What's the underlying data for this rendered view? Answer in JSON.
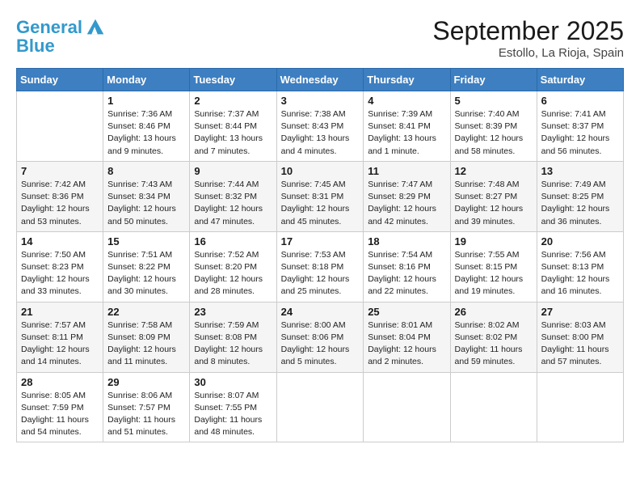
{
  "header": {
    "logo_line1": "General",
    "logo_line2": "Blue",
    "month_title": "September 2025",
    "location": "Estollo, La Rioja, Spain"
  },
  "weekdays": [
    "Sunday",
    "Monday",
    "Tuesday",
    "Wednesday",
    "Thursday",
    "Friday",
    "Saturday"
  ],
  "weeks": [
    [
      {
        "num": "",
        "info": ""
      },
      {
        "num": "1",
        "info": "Sunrise: 7:36 AM\nSunset: 8:46 PM\nDaylight: 13 hours\nand 9 minutes."
      },
      {
        "num": "2",
        "info": "Sunrise: 7:37 AM\nSunset: 8:44 PM\nDaylight: 13 hours\nand 7 minutes."
      },
      {
        "num": "3",
        "info": "Sunrise: 7:38 AM\nSunset: 8:43 PM\nDaylight: 13 hours\nand 4 minutes."
      },
      {
        "num": "4",
        "info": "Sunrise: 7:39 AM\nSunset: 8:41 PM\nDaylight: 13 hours\nand 1 minute."
      },
      {
        "num": "5",
        "info": "Sunrise: 7:40 AM\nSunset: 8:39 PM\nDaylight: 12 hours\nand 58 minutes."
      },
      {
        "num": "6",
        "info": "Sunrise: 7:41 AM\nSunset: 8:37 PM\nDaylight: 12 hours\nand 56 minutes."
      }
    ],
    [
      {
        "num": "7",
        "info": "Sunrise: 7:42 AM\nSunset: 8:36 PM\nDaylight: 12 hours\nand 53 minutes."
      },
      {
        "num": "8",
        "info": "Sunrise: 7:43 AM\nSunset: 8:34 PM\nDaylight: 12 hours\nand 50 minutes."
      },
      {
        "num": "9",
        "info": "Sunrise: 7:44 AM\nSunset: 8:32 PM\nDaylight: 12 hours\nand 47 minutes."
      },
      {
        "num": "10",
        "info": "Sunrise: 7:45 AM\nSunset: 8:31 PM\nDaylight: 12 hours\nand 45 minutes."
      },
      {
        "num": "11",
        "info": "Sunrise: 7:47 AM\nSunset: 8:29 PM\nDaylight: 12 hours\nand 42 minutes."
      },
      {
        "num": "12",
        "info": "Sunrise: 7:48 AM\nSunset: 8:27 PM\nDaylight: 12 hours\nand 39 minutes."
      },
      {
        "num": "13",
        "info": "Sunrise: 7:49 AM\nSunset: 8:25 PM\nDaylight: 12 hours\nand 36 minutes."
      }
    ],
    [
      {
        "num": "14",
        "info": "Sunrise: 7:50 AM\nSunset: 8:23 PM\nDaylight: 12 hours\nand 33 minutes."
      },
      {
        "num": "15",
        "info": "Sunrise: 7:51 AM\nSunset: 8:22 PM\nDaylight: 12 hours\nand 30 minutes."
      },
      {
        "num": "16",
        "info": "Sunrise: 7:52 AM\nSunset: 8:20 PM\nDaylight: 12 hours\nand 28 minutes."
      },
      {
        "num": "17",
        "info": "Sunrise: 7:53 AM\nSunset: 8:18 PM\nDaylight: 12 hours\nand 25 minutes."
      },
      {
        "num": "18",
        "info": "Sunrise: 7:54 AM\nSunset: 8:16 PM\nDaylight: 12 hours\nand 22 minutes."
      },
      {
        "num": "19",
        "info": "Sunrise: 7:55 AM\nSunset: 8:15 PM\nDaylight: 12 hours\nand 19 minutes."
      },
      {
        "num": "20",
        "info": "Sunrise: 7:56 AM\nSunset: 8:13 PM\nDaylight: 12 hours\nand 16 minutes."
      }
    ],
    [
      {
        "num": "21",
        "info": "Sunrise: 7:57 AM\nSunset: 8:11 PM\nDaylight: 12 hours\nand 14 minutes."
      },
      {
        "num": "22",
        "info": "Sunrise: 7:58 AM\nSunset: 8:09 PM\nDaylight: 12 hours\nand 11 minutes."
      },
      {
        "num": "23",
        "info": "Sunrise: 7:59 AM\nSunset: 8:08 PM\nDaylight: 12 hours\nand 8 minutes."
      },
      {
        "num": "24",
        "info": "Sunrise: 8:00 AM\nSunset: 8:06 PM\nDaylight: 12 hours\nand 5 minutes."
      },
      {
        "num": "25",
        "info": "Sunrise: 8:01 AM\nSunset: 8:04 PM\nDaylight: 12 hours\nand 2 minutes."
      },
      {
        "num": "26",
        "info": "Sunrise: 8:02 AM\nSunset: 8:02 PM\nDaylight: 11 hours\nand 59 minutes."
      },
      {
        "num": "27",
        "info": "Sunrise: 8:03 AM\nSunset: 8:00 PM\nDaylight: 11 hours\nand 57 minutes."
      }
    ],
    [
      {
        "num": "28",
        "info": "Sunrise: 8:05 AM\nSunset: 7:59 PM\nDaylight: 11 hours\nand 54 minutes."
      },
      {
        "num": "29",
        "info": "Sunrise: 8:06 AM\nSunset: 7:57 PM\nDaylight: 11 hours\nand 51 minutes."
      },
      {
        "num": "30",
        "info": "Sunrise: 8:07 AM\nSunset: 7:55 PM\nDaylight: 11 hours\nand 48 minutes."
      },
      {
        "num": "",
        "info": ""
      },
      {
        "num": "",
        "info": ""
      },
      {
        "num": "",
        "info": ""
      },
      {
        "num": "",
        "info": ""
      }
    ]
  ]
}
